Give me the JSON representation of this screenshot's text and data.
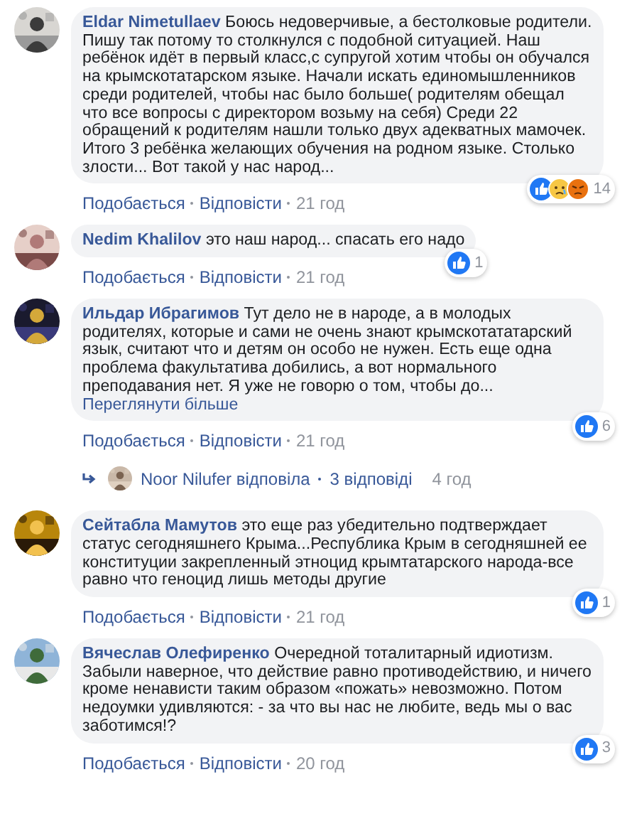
{
  "comments": [
    {
      "author": "Eldar Nimetullaev",
      "text": "Боюсь недоверчивые, а бестолковые родители. Пишу так потому то столкнулся с подобной ситуацией. Наш ребёнок идёт в первый класс,с супругой хотим чтобы он обучался на крымскотатарском языке. Начали искать единомышленников среди родителей, чтобы нас было больше( родителям обещал что все вопросы с директором возьму на себя) Среди 22 обращений к родителям нашли только двух адекватных мамочек. Итого 3 ребёнка желающих обучения на родном языке. Столько злости... Вот такой у нас народ...",
      "reactions": {
        "items": [
          {
            "kind": "like"
          },
          {
            "kind": "sad"
          },
          {
            "kind": "angry"
          }
        ],
        "count": "14"
      },
      "like_label": "Подобається",
      "reply_label": "Відповісти",
      "time": "21 год"
    },
    {
      "author": "Nedim Khalilov",
      "text": "это наш народ... спасать его надо",
      "reactions": {
        "items": [
          {
            "kind": "like"
          }
        ],
        "count": "1"
      },
      "like_label": "Подобається",
      "reply_label": "Відповісти",
      "time": "21 год"
    },
    {
      "author": "Ильдар Ибрагимов",
      "text": "Тут дело не в народе, а в молодых родителях, которые и сами не очень знают крымскотататарский язык, считают что и детям он особо не нужен. Есть еще одна проблема факультатива добились, а вот нормального преподавания нет. Я уже не говорю о том, чтобы до...",
      "see_more": "Переглянути більше",
      "reactions": {
        "items": [
          {
            "kind": "like"
          }
        ],
        "count": "6"
      },
      "like_label": "Подобається",
      "reply_label": "Відповісти",
      "time": "21 год",
      "replies": {
        "summary": "Noor Nilufer відповіла",
        "count": "3 відповіді",
        "time": "4 год"
      }
    },
    {
      "author": "Сейтабла Мамутов",
      "text": "это еще раз убедительно подтверждает статус сегодняшнего Крыма...Республика Крым в сегодняшней ее конституции закрепленный этноцид крымтатарского народа-все равно что геноцид лишь методы другие",
      "reactions": {
        "items": [
          {
            "kind": "like"
          }
        ],
        "count": "1"
      },
      "like_label": "Подобається",
      "reply_label": "Відповісти",
      "time": "21 год"
    },
    {
      "author": "Вячеслав Олефиренко",
      "text": "Очередной тоталитарный идиотизм. Забыли наверное, что действие равно противодействию, и ничего кроме ненависти таким образом «пожать» невозможно. Потом недоумки удивляются: - за что вы нас не любите, ведь мы о вас заботимся!?",
      "reactions": {
        "items": [
          {
            "kind": "like"
          }
        ],
        "count": "3"
      },
      "like_label": "Подобається",
      "reply_label": "Відповісти",
      "time": "20 год"
    }
  ]
}
